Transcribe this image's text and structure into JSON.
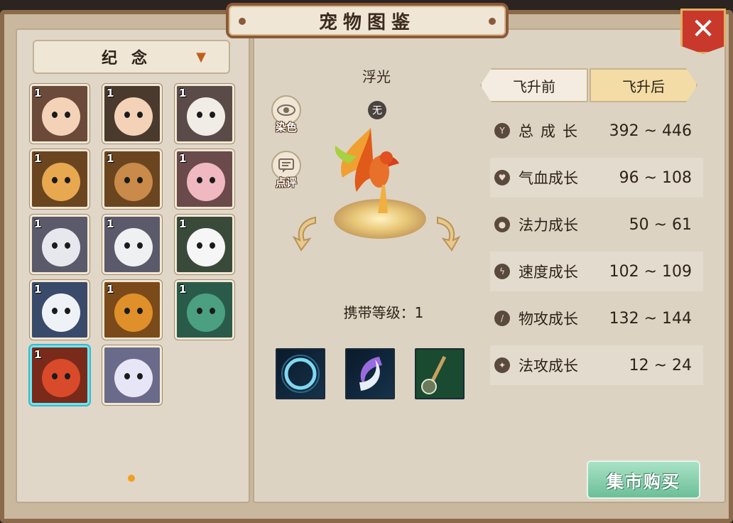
{
  "title": "宠物图鉴",
  "close_label": "✕",
  "dropdown": {
    "label": "纪念",
    "arrow": "▼"
  },
  "pets": [
    {
      "level": "1",
      "color": "#6b4a3a",
      "skin": "#f3d2b8",
      "name": "pet-child-girl"
    },
    {
      "level": "1",
      "color": "#4a3a2e",
      "skin": "#f3d2b8",
      "name": "pet-child-boy"
    },
    {
      "level": "1",
      "color": "#5b4b48",
      "skin": "#f1ece6",
      "name": "pet-siamese-cat"
    },
    {
      "level": "1",
      "color": "#6a4520",
      "skin": "#e8a850",
      "name": "pet-tiger-cub"
    },
    {
      "level": "1",
      "color": "#6a4520",
      "skin": "#c98a4a",
      "name": "pet-fox"
    },
    {
      "level": "1",
      "color": "#6a4a4a",
      "skin": "#f0b8c0",
      "name": "pet-pink-deer"
    },
    {
      "level": "1",
      "color": "#5a5a6a",
      "skin": "#e6e8ee",
      "name": "pet-white-hair-boy"
    },
    {
      "level": "1",
      "color": "#5a5a6a",
      "skin": "#eef0f2",
      "name": "pet-white-hair-girl"
    },
    {
      "level": "1",
      "color": "#3a4a3a",
      "skin": "#f6f6f6",
      "name": "pet-panda"
    },
    {
      "level": "1",
      "color": "#3a4a6a",
      "skin": "#eef2f6",
      "name": "pet-polar-bear"
    },
    {
      "level": "1",
      "color": "#7a4a1a",
      "skin": "#e0902a",
      "name": "pet-lion-cub"
    },
    {
      "level": "1",
      "color": "#2a5a4a",
      "skin": "#4aa080",
      "name": "pet-green-dragon"
    },
    {
      "level": "1",
      "color": "#7a2a1a",
      "skin": "#d84a2a",
      "name": "pet-phoenix"
    },
    {
      "level": "",
      "color": "#6a6a8a",
      "skin": "#e6e6f6",
      "name": "pet-white-beast"
    }
  ],
  "selected_index": 12,
  "pet_name": "浮光",
  "none_badge": "无",
  "dye_label": "染色",
  "review_label": "点评",
  "carry_level": "携带等级：1",
  "tabs": {
    "before": "飞升前",
    "after": "飞升后",
    "active": "after"
  },
  "stats": [
    {
      "label": "总成长",
      "value": "392 ~ 446",
      "icon": "Y",
      "spaced": true
    },
    {
      "label": "气血成长",
      "value": "96 ~ 108",
      "icon": "♥",
      "spaced": false
    },
    {
      "label": "法力成长",
      "value": "50 ~ 61",
      "icon": "●",
      "spaced": false
    },
    {
      "label": "速度成长",
      "value": "102 ~ 109",
      "icon": "ϟ",
      "spaced": false
    },
    {
      "label": "物攻成长",
      "value": "132 ~ 144",
      "icon": "/",
      "spaced": false
    },
    {
      "label": "法攻成长",
      "value": "12 ~ 24",
      "icon": "✦",
      "spaced": false
    }
  ],
  "market_button": "集市购买",
  "colors": {
    "accent": "#c8392b",
    "frame": "#8a6a4a",
    "market": "#6cbf98"
  }
}
